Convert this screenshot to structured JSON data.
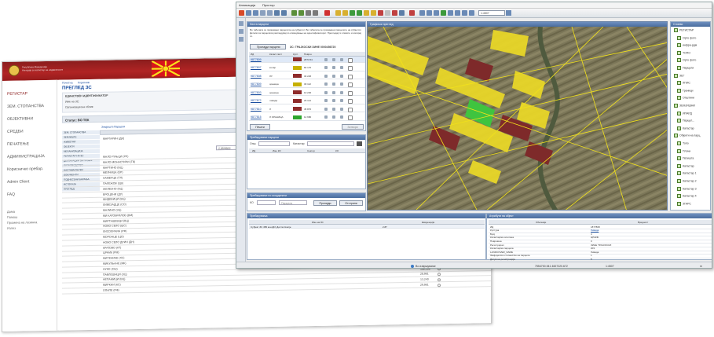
{
  "back_window": {
    "brand_lines": [
      "Република Македонија",
      "Агенција за катастар на недвижности"
    ],
    "sidebar_items": [
      "РЕГИСТАР",
      "ЗЕМ. СТОПАНСТВА",
      "ОБЈЕКТИВНИ",
      "СРЕДБИ",
      "ПЕЧАТЕЊЕ",
      "АДМИНИСТРАЦИЈА",
      "Корисничко пребар.",
      "Admin Client",
      "FAQ"
    ],
    "sidebar_links": [
      "Дома",
      "Помош",
      "Промена на лозинка",
      "Излез"
    ],
    "tabs": [
      "Почетна",
      "Корисник"
    ],
    "section_title": "ПРЕГЛЕД ЗС",
    "form_lines": [
      "ЕДИНСТВЕН ИДЕНТИФИКАТОР",
      "Име на ЗС:",
      "Организациона облик:"
    ],
    "status_label": "Статус: ВО ТЕК",
    "subtabs": [
      "Земјиште",
      "Парцели"
    ],
    "side_tabs": [
      "ЗЕМ. СТОПАНСТВА",
      "ЗЕМЈИШТЕ",
      "ЖИВОТНИ",
      "ОБЈЕКТИ",
      "МЕХАНИЗАЦИЈА",
      "РЕГИСТАР НА ЗС",
      "ДЕКЛАРАЦИИ ЗА ПРОИЗ.",
      "ПРОИЗВОДСТВО",
      "НАСТАВА/ОБУКИ",
      "ДОКУМЕНТИ",
      "ПОДНЕСЕНИ БАРАЊА",
      "ИСТОРИЈА",
      "ПРЕГЛЕД"
    ],
    "col_header_right": "Обработено",
    "col_header_mid": "Број на парцели",
    "first_row_label": "МАРГАРИН (ДИ)",
    "first_row_value": "2,05/0022",
    "rows": [
      {
        "label": "МАЛО РУЊЦИ (РР)",
        "value": ""
      },
      {
        "label": "МАЛО МОНАСТИРИ (ГВ)",
        "value": ""
      },
      {
        "label": "МАРТИНО (БЦ)",
        "value": ""
      },
      {
        "label": "МЕЛНИЦА (ЕР)",
        "value": ""
      },
      {
        "label": "НАМЕРЦЕ (ТЛ)",
        "value": ""
      },
      {
        "label": "ПАЛЕЖОВ (ЦВ)",
        "value": ""
      },
      {
        "label": "ЖЕЛЕЗНО (КЦ)",
        "value": ""
      },
      {
        "label": "БРОЦЕНИ (ДУ)",
        "value": ""
      },
      {
        "label": "ШИДЕВИЦИ (ВЦ)",
        "value": ""
      },
      {
        "label": "ЛИВЕЗАДЦЕ (СО)",
        "value": ""
      },
      {
        "label": "МАЛИНО (ЗЦ)",
        "value": ""
      },
      {
        "label": "МИ КАТОВРИЛОВ (ВМ)",
        "value": ""
      },
      {
        "label": "МИРТАШЕВЦИ (ВЦ)",
        "value": ""
      },
      {
        "label": "НОВО СЕЛО (ШС)",
        "value": ""
      },
      {
        "label": "ЛИСОЛИЧИН (РФ)",
        "value": ""
      },
      {
        "label": "МОРОНЦЕ (ЦО)",
        "value": "15,960"
      },
      {
        "label": "НОВО СЕЛО ДРИН (ДН)",
        "value": "29,961"
      },
      {
        "label": "КРАТОВО (КТ)",
        "value": "6,113"
      },
      {
        "label": "ЦРНИК (РМ)",
        "value": "59,400"
      },
      {
        "label": "МИТЕНИКЕ (ХС)",
        "value": "15,990"
      },
      {
        "label": "МИКУЛЬАНЕ (МК)",
        "value": "25,862"
      },
      {
        "label": "НУНЕ (СШ)",
        "value": "15,860"
      },
      {
        "label": "ПАВЛЕШНЦИ (ЗЦ)",
        "value": "106,296"
      },
      {
        "label": "НЕПАМИЦИ (ВЦ)",
        "value": "28,961"
      },
      {
        "label": "МИРКНИ (КС)",
        "value": "13,240"
      },
      {
        "label": "ОПАПЕ (РФ)",
        "value": "29,961"
      }
    ]
  },
  "front_window": {
    "menu": [
      "Апликација",
      "Простор"
    ],
    "scale_value": "1:4507",
    "parcels_panel": {
      "title": "Листа парцели",
      "info_text": "Во табелата се прикажани парцелите на субјектот. Во табелата се прикажани парцелите на субјектот. Детали за парцелата разгледувај со кликнување на идентификаторот. Прегледај ги сликите и копирај ги.",
      "search_button": "Пронајди парцели",
      "owner_line": "ЗС: ТРАЈКОСКИ ЗИНЕ 0000456720",
      "headers": [
        "ИД",
        "Катаст.лист",
        "Култ.",
        "Површ."
      ],
      "rows": [
        {
          "id": "9877809",
          "name": "",
          "area": "2873.54",
          "chip": "#8e2b2b"
        },
        {
          "id": "9877807",
          "name": "колар",
          "area": "82 170",
          "chip": "#c6b000"
        },
        {
          "id": "9877808",
          "name": "ЛУ",
          "area": "34 226",
          "chip": "#8e2b2b"
        },
        {
          "id": "9877809",
          "name": "ораница",
          "area": "30 112",
          "chip": "#c6b000"
        },
        {
          "id": "9877803",
          "name": "ораница",
          "area": "10 230",
          "chip": "#8e2b2b"
        },
        {
          "id": "9877872",
          "name": "ливада",
          "area": "29 114",
          "chip": "#8e2b2b"
        },
        {
          "id": "9877810",
          "name": "Л",
          "area": "45 870",
          "chip": "#8e2b2b"
        },
        {
          "id": "9877815",
          "name": "Л ОРАНИЦА",
          "area": "12 680",
          "chip": "#2ea62e"
        }
      ],
      "bottom_left": "Печати",
      "bottom_right": "Затвори"
    },
    "search_panel": {
      "title": "Пребарување парцели",
      "label_left": "Опш.",
      "label_mid": "Катастар",
      "headers": [
        "ИД",
        "Име КО",
        "Сектор",
        "КО"
      ]
    },
    "coord_panel": {
      "title": "Пребарување по координати",
      "label": "КО",
      "placeholder": "Парцела",
      "btn1": "Пронајди",
      "btn2": "Отстрани"
    },
    "map_title": "Графички преглед",
    "layers_panel": {
      "title": "Слоеви",
      "items": [
        "РЕГИСТАР",
        "Орто фото",
        "инфра-рдм",
        "ТОПО",
        "Орто фото",
        "Парцели",
        "ЗЕГ",
        "ЛПИС",
        "Граници",
        "Општини",
        "ЗЕМЈИШНИ",
        "ИПАРД",
        "Парцел...",
        "Катастар",
        "Објекти на парц.",
        "Топо",
        "Плочи",
        "Патишта",
        "Катастар",
        "Катастар 1",
        "Катастар 2",
        "Катастар 3",
        "Катастар 4",
        "ЗГАРС"
      ]
    },
    "attributes_panel": {
      "title": "Атрибути на објект",
      "headers": [
        "Обележје",
        "Вредност"
      ],
      "rows": [
        {
          "k": "ИД",
          "v": "1877808"
        },
        {
          "k": "Култура",
          "v": "Ливада"
        },
        {
          "k": "Број",
          "v": "4"
        },
        {
          "k": "Катастарска општина",
          "v": "ЦРНИК"
        },
        {
          "k": "Површина",
          "v": "0"
        },
        {
          "k": "Регистрирал",
          "v": "ЗИНЕ ТРАЈКОСКИ"
        },
        {
          "k": "Катастарска парцела",
          "v": "203"
        },
        {
          "k": "LANDCOVER_NAME",
          "v": "Ливада"
        },
        {
          "k": "Земјоделско стопанство на парцела",
          "v": "1"
        },
        {
          "k": "Датум на регистрација",
          "v": "5"
        }
      ]
    },
    "subjects_panel": {
      "title": "Пребарувања",
      "headers": [
        "Име на ЗС",
        "Евиденција"
      ],
      "row": "Субјект   ЗС 456 кон ДИ, Доста Скопје",
      "row_value": "2.87"
    },
    "status": {
      "left": "Во извршување",
      "coords": "7554700.941 4607220.672",
      "zoom": "1:4507",
      "right_unit": "m"
    }
  }
}
